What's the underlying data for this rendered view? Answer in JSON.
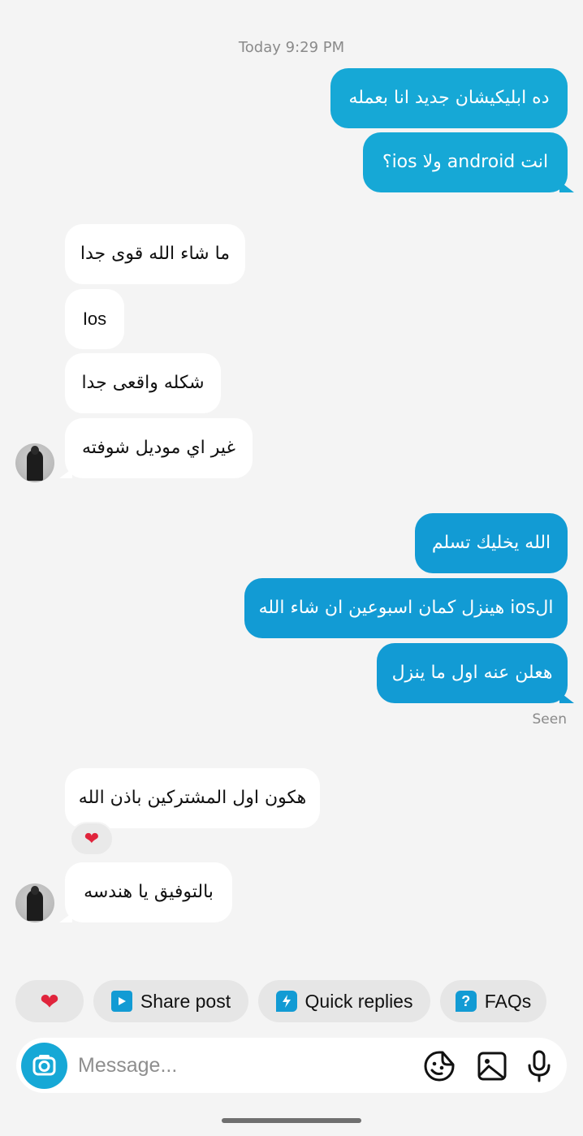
{
  "timestamp": "Today 9:29 PM",
  "messages": [
    {
      "side": "out",
      "text": "ده ابليكيشان جديد انا بعمله"
    },
    {
      "side": "out",
      "text": "انت android ولا ios؟"
    },
    {
      "side": "in",
      "text": "ما شاء الله قوى جدا"
    },
    {
      "side": "in",
      "text": "Ios"
    },
    {
      "side": "in",
      "text": "شكله واقعى جدا"
    },
    {
      "side": "in",
      "text": "غير اي موديل شوفته"
    },
    {
      "side": "out",
      "text": "الله يخليك تسلم"
    },
    {
      "side": "out",
      "text": "الios هينزل كمان اسبوعين ان شاء الله"
    },
    {
      "side": "out",
      "text": "هعلن عنه اول ما ينزل"
    },
    {
      "side": "in",
      "text": "هكون اول المشتركين باذن الله"
    },
    {
      "side": "in",
      "text": "بالتوفيق يا هندسه"
    }
  ],
  "status": {
    "seen": "Seen"
  },
  "reaction": {
    "emoji": "❤"
  },
  "quick_actions": {
    "heart": "❤",
    "share_post": "Share post",
    "quick_replies": "Quick replies",
    "faqs": "FAQs"
  },
  "composer": {
    "placeholder": "Message...",
    "icons": [
      "camera-icon",
      "sticker-icon",
      "gallery-icon",
      "microphone-icon"
    ]
  },
  "colors": {
    "outgoing_bubble": "#16a8d6",
    "outgoing_bubble_alt": "#129bd4",
    "incoming_bubble": "#ffffff",
    "background": "#f4f4f4",
    "heart": "#e0243c"
  }
}
